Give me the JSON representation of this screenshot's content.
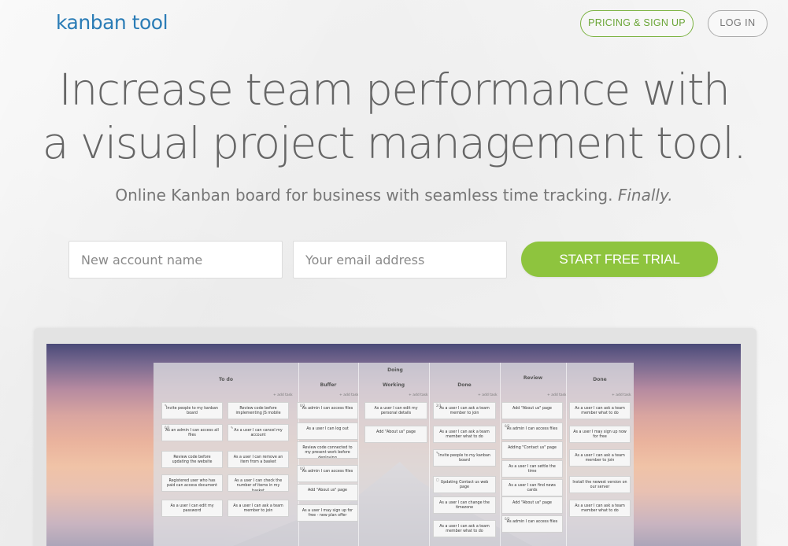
{
  "header": {
    "logo_text": "kanban tool",
    "pricing_label": "PRICING & SIGN UP",
    "login_label": "LOG IN"
  },
  "hero": {
    "headline_line1": "Increase team performance with",
    "headline_line2": "a visual project management tool.",
    "subline": "Online Kanban board for business with seamless time tracking.",
    "subline_emph": "Finally."
  },
  "signup": {
    "account_placeholder": "New account name",
    "email_placeholder": "Your email address",
    "cta_label": "START FREE TRIAL"
  },
  "board": {
    "headers": {
      "todo": "To do",
      "doing": "Doing",
      "buffer": "Buffer",
      "working": "Working",
      "done_mid": "Done",
      "review": "Review",
      "done": "Done"
    },
    "add_task": "+ add task",
    "todo_left": [
      {
        "meta": "✎",
        "text": "Invite people to my kanban board"
      },
      {
        "meta": "0/3",
        "text": "As an admin I can access all files"
      },
      {
        "meta": "",
        "text": "Review code before updating the website"
      },
      {
        "meta": "",
        "text": "Registered user who has paid can access document"
      },
      {
        "meta": "",
        "text": "As a user I can edit my password"
      }
    ],
    "todo_right": [
      {
        "meta": "",
        "text": "Review code before implementing JS mobile"
      },
      {
        "meta": "✎",
        "text": "As a user I can cancel my account"
      },
      {
        "meta": "",
        "text": "As a user I can remove an item from a basket"
      },
      {
        "meta": "",
        "text": "As a user I can check the number of items in my basket"
      },
      {
        "meta": "",
        "text": "As a user I can ask a team member to join"
      }
    ],
    "buffer": [
      {
        "meta": "0/3",
        "text": "As admin I can access files"
      },
      {
        "meta": "",
        "text": "As a user I can log out"
      },
      {
        "meta": "",
        "text": "Review code connected to my present work before deploying"
      },
      {
        "meta": "0/3",
        "text": "As admin I can access files"
      },
      {
        "meta": "",
        "text": "Add \"About us\" page"
      },
      {
        "meta": "",
        "text": "As a user I may sign up for free - new plan offer"
      }
    ],
    "working": [
      {
        "meta": "",
        "text": "As a user I can edit my personal details"
      },
      {
        "meta": "",
        "text": "Add \"About us\" page"
      }
    ],
    "done_mid": [
      {
        "meta": "2/3",
        "text": "As a user I can ask a team member to join"
      },
      {
        "meta": "",
        "text": "As a user I can ask a team member what to do"
      },
      {
        "meta": "✎",
        "text": "Invite people to my kanban board"
      },
      {
        "meta": "▢",
        "text": "Updating Contact us web page"
      },
      {
        "meta": "",
        "text": "As a user I can change the timezone"
      },
      {
        "meta": "",
        "text": "As a user I can ask a team member what to do"
      }
    ],
    "review": [
      {
        "meta": "",
        "text": "Add \"About us\" page"
      },
      {
        "meta": "0/3",
        "text": "As admin I can access files"
      },
      {
        "meta": "",
        "text": "Adding \"Contact us\" page"
      },
      {
        "meta": "",
        "text": "As a user I can settle the time"
      },
      {
        "meta": "",
        "text": "As a user I can find news cards"
      },
      {
        "meta": "",
        "text": "Add \"About us\" page"
      },
      {
        "meta": "0/3",
        "text": "As admin I can access files"
      }
    ],
    "done": [
      {
        "meta": "",
        "text": "As a user I can ask a team member what to do"
      },
      {
        "meta": "",
        "text": "As a user I may sign up now for free"
      },
      {
        "meta": "",
        "text": "As a user I can ask a team member to join"
      },
      {
        "meta": "",
        "text": "Install the newest version on our server"
      },
      {
        "meta": "",
        "text": "As a user I can ask a team member what to do"
      }
    ]
  }
}
